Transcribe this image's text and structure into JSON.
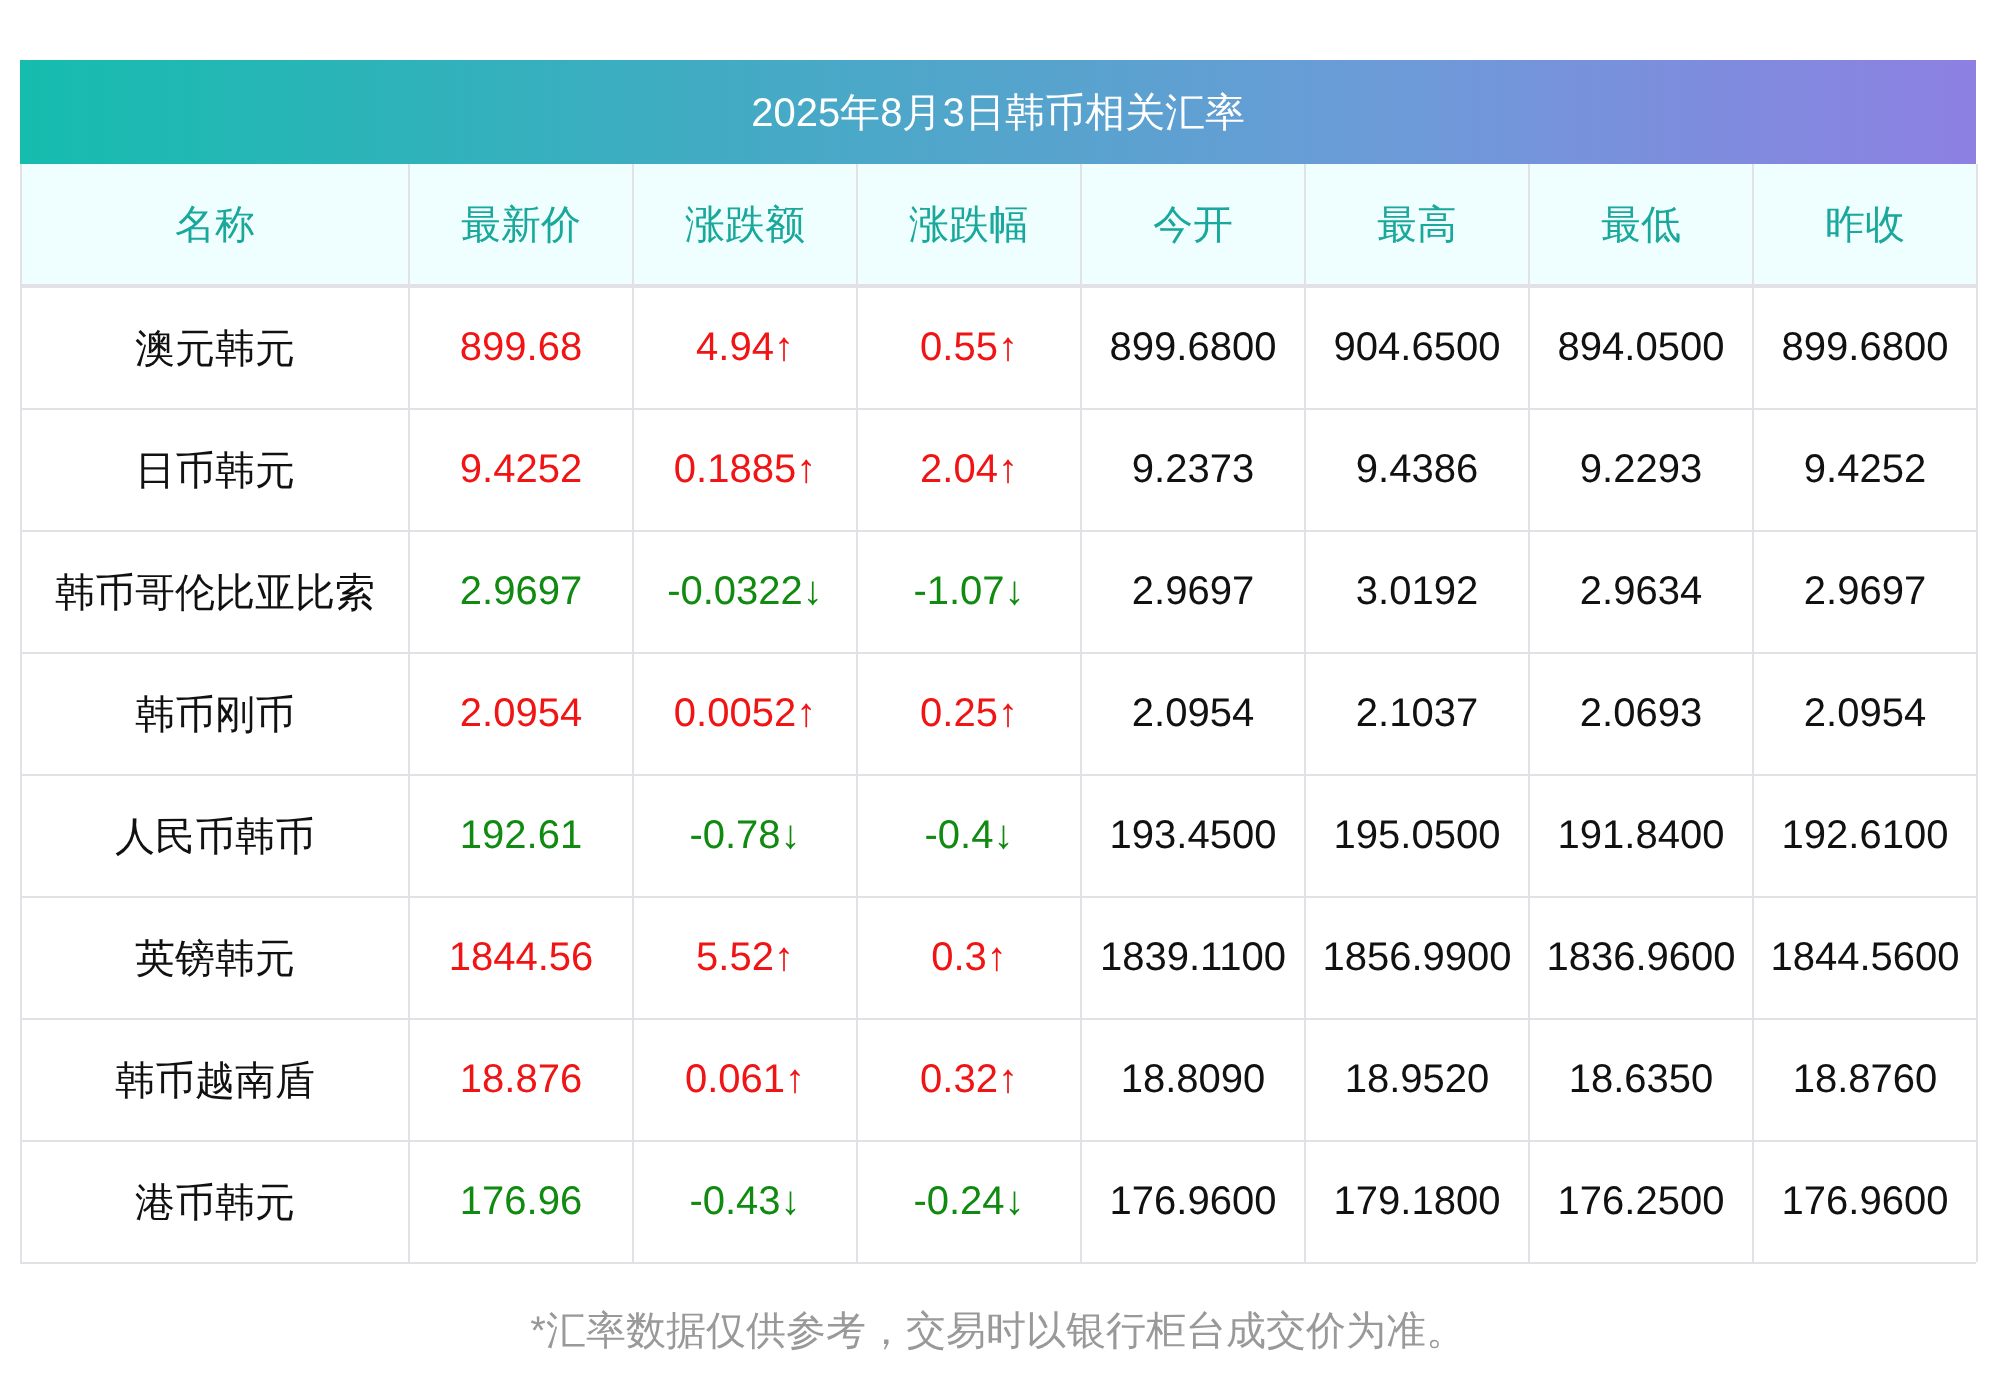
{
  "title": "2025年8月3日韩币相关汇率",
  "columns": [
    "名称",
    "最新价",
    "涨跌额",
    "涨跌幅",
    "今开",
    "最高",
    "最低",
    "昨收"
  ],
  "rows": [
    {
      "name": "澳元韩元",
      "kind": "up",
      "latest": "899.68",
      "change": "4.94↑",
      "pct": "0.55↑",
      "open": "899.6800",
      "high": "904.6500",
      "low": "894.0500",
      "prev": "899.6800"
    },
    {
      "name": "日币韩元",
      "kind": "up",
      "latest": "9.4252",
      "change": "0.1885↑",
      "pct": "2.04↑",
      "open": "9.2373",
      "high": "9.4386",
      "low": "9.2293",
      "prev": "9.4252"
    },
    {
      "name": "韩币哥伦比亚比索",
      "kind": "down",
      "latest": "2.9697",
      "change": "-0.0322↓",
      "pct": "-1.07↓",
      "open": "2.9697",
      "high": "3.0192",
      "low": "2.9634",
      "prev": "2.9697"
    },
    {
      "name": "韩币刚币",
      "kind": "up",
      "latest": "2.0954",
      "change": "0.0052↑",
      "pct": "0.25↑",
      "open": "2.0954",
      "high": "2.1037",
      "low": "2.0693",
      "prev": "2.0954"
    },
    {
      "name": "人民币韩币",
      "kind": "down",
      "latest": "192.61",
      "change": "-0.78↓",
      "pct": "-0.4↓",
      "open": "193.4500",
      "high": "195.0500",
      "low": "191.8400",
      "prev": "192.6100"
    },
    {
      "name": "英镑韩元",
      "kind": "up",
      "latest": "1844.56",
      "change": "5.52↑",
      "pct": "0.3↑",
      "open": "1839.1100",
      "high": "1856.9900",
      "low": "1836.9600",
      "prev": "1844.5600"
    },
    {
      "name": "韩币越南盾",
      "kind": "up",
      "latest": "18.876",
      "change": "0.061↑",
      "pct": "0.32↑",
      "open": "18.8090",
      "high": "18.9520",
      "low": "18.6350",
      "prev": "18.8760"
    },
    {
      "name": "港币韩元",
      "kind": "down",
      "latest": "176.96",
      "change": "-0.43↓",
      "pct": "-0.24↓",
      "open": "176.9600",
      "high": "179.1800",
      "low": "176.2500",
      "prev": "176.9600"
    }
  ],
  "footnote": "*汇率数据仅供参考，交易时以银行柜台成交价为准。"
}
